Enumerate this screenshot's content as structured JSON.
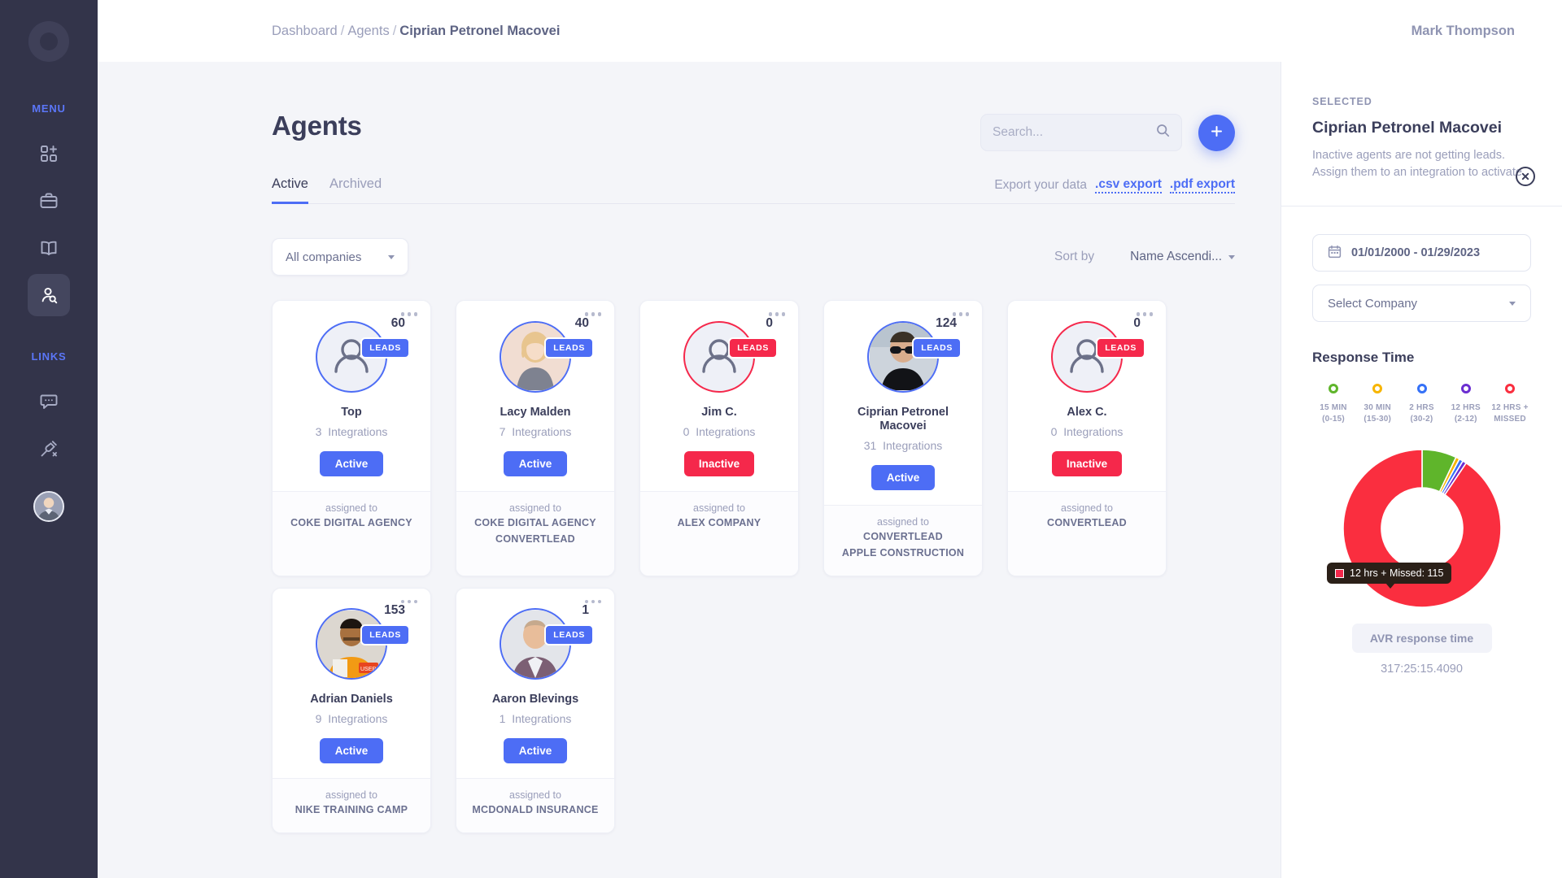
{
  "sidebar": {
    "logo_icon": "convertlead-c-logo",
    "menu_label": "MENU",
    "links_label": "LINKS",
    "menu_items": [
      {
        "icon": "grid-plus-icon",
        "name": "dashboard",
        "active": false
      },
      {
        "icon": "briefcase-icon",
        "name": "companies",
        "active": false
      },
      {
        "icon": "book-icon",
        "name": "leads",
        "active": false
      },
      {
        "icon": "user-search-icon",
        "name": "agents",
        "active": true
      }
    ],
    "link_items": [
      {
        "icon": "chat-bubble-icon",
        "name": "messages"
      },
      {
        "icon": "plug-disconnected-icon",
        "name": "integrations"
      }
    ],
    "avatar_icon": "user-avatar"
  },
  "topbar": {
    "breadcrumb": [
      {
        "label": "Dashboard",
        "current": false
      },
      {
        "label": "Agents",
        "current": false
      },
      {
        "label": "Ciprian Petronel Macovei",
        "current": true
      }
    ],
    "separator": "/",
    "username": "Mark Thompson"
  },
  "main": {
    "page_title": "Agents",
    "search": {
      "value": "",
      "placeholder": "Search...",
      "icon": "search-icon"
    },
    "add_button": {
      "icon": "plus-icon",
      "label": "+"
    },
    "tabs": [
      {
        "label": "Active",
        "active": true
      },
      {
        "label": "Archived",
        "active": false
      }
    ],
    "export": {
      "label": "Export your data",
      "csv": ".csv export",
      "pdf": ".pdf export"
    },
    "filters": {
      "company_select": "All companies",
      "sort_label": "Sort by",
      "sort_value": "Name Ascendi..."
    },
    "card_labels": {
      "leads_badge": "LEADS",
      "integrations_suffix": "Integrations",
      "assigned_to": "assigned to",
      "menu_icon": "more-options-icon"
    },
    "agents": [
      {
        "name": "Top",
        "leads": "60",
        "integrations": "3",
        "status": "Active",
        "active": true,
        "avatar": "placeholder",
        "companies": [
          "COKE DIGITAL AGENCY"
        ]
      },
      {
        "name": "Lacy Malden",
        "leads": "40",
        "integrations": "7",
        "status": "Active",
        "active": true,
        "avatar": "photo-woman-blonde",
        "companies": [
          "COKE DIGITAL AGENCY",
          "CONVERTLEAD"
        ]
      },
      {
        "name": "Jim C.",
        "leads": "0",
        "integrations": "0",
        "status": "Inactive",
        "active": false,
        "avatar": "placeholder",
        "companies": [
          "ALEX COMPANY"
        ]
      },
      {
        "name": "Ciprian Petronel Macovei",
        "leads": "124",
        "integrations": "31",
        "status": "Active",
        "active": true,
        "avatar": "photo-man-sunglasses",
        "companies": [
          "CONVERTLEAD",
          "APPLE CONSTRUCTION"
        ]
      },
      {
        "name": "Alex C.",
        "leads": "0",
        "integrations": "0",
        "status": "Inactive",
        "active": false,
        "avatar": "placeholder",
        "companies": [
          "CONVERTLEAD"
        ]
      },
      {
        "name": "Adrian Daniels",
        "leads": "153",
        "integrations": "9",
        "status": "Active",
        "active": true,
        "avatar": "photo-man-orange-hoodie",
        "companies": [
          "NIKE TRAINING CAMP"
        ]
      },
      {
        "name": "Aaron Blevings",
        "leads": "1",
        "integrations": "1",
        "status": "Active",
        "active": true,
        "avatar": "photo-man-suit",
        "companies": [
          "MCDONALD INSURANCE"
        ]
      }
    ]
  },
  "panel": {
    "selected_label": "SELECTED",
    "title": "Ciprian Petronel Macovei",
    "description": "Inactive agents are not getting leads.\nAssign them to an integration to activate.",
    "close_icon": "close-circle-icon",
    "date_range": "01/01/2000 - 01/29/2023",
    "calendar_icon": "calendar-icon",
    "company_select": "Select Company",
    "response_time_title": "Response Time",
    "avr_label": "AVR response time",
    "avr_value": "317:25:15.4090",
    "tooltip": "12 hrs + Missed: 115"
  },
  "colors": {
    "accent_blue": "#4d6df5",
    "danger_red": "#f5284b",
    "sidebar_bg": "#33344a",
    "page_bg": "#f4f5f9",
    "green": "#5fb52b",
    "amber": "#f7b500",
    "blue": "#3571f7",
    "purple": "#6b2ed1",
    "red": "#fa2e3f"
  },
  "chart_data": {
    "type": "pie",
    "title": "Response Time",
    "legend_position": "top",
    "labels": [
      "15 MIN (0-15)",
      "30 MIN (15-30)",
      "2 HRS (30-2)",
      "12 HRS (2-12)",
      "12 HRS + MISSED"
    ],
    "legend": [
      {
        "line1": "15 MIN",
        "line2": "(0-15)",
        "color": "#5fb52b"
      },
      {
        "line1": "30 MIN",
        "line2": "(15-30)",
        "color": "#f7b500"
      },
      {
        "line1": "2 HRS",
        "line2": "(30-2)",
        "color": "#3571f7"
      },
      {
        "line1": "12 HRS",
        "line2": "(2-12)",
        "color": "#6b2ed1"
      },
      {
        "line1": "12 HRS +",
        "line2": "MISSED",
        "color": "#fa2e3f"
      }
    ],
    "values": [
      9,
      1,
      1,
      1,
      115
    ],
    "colors": [
      "#5fb52b",
      "#f7b500",
      "#3571f7",
      "#6b2ed1",
      "#fa2e3f"
    ],
    "highlighted": "12 HRS + MISSED",
    "highlighted_value": 115,
    "total": 127
  }
}
